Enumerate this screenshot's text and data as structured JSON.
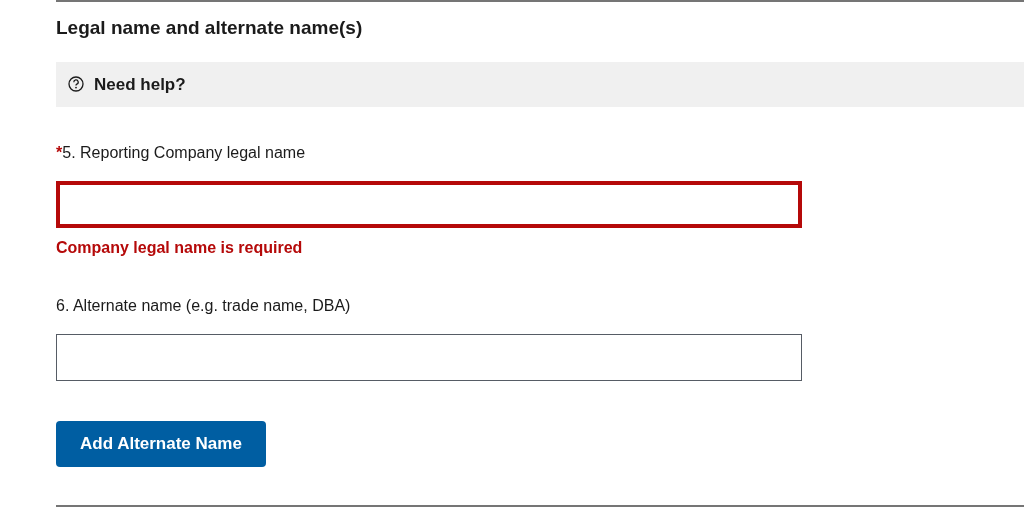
{
  "section": {
    "title": "Legal name and alternate name(s)"
  },
  "help": {
    "label": "Need help?"
  },
  "fields": [
    {
      "required_mark": "*",
      "label": "5. Reporting Company legal name",
      "invalid": true,
      "error": "Company legal name is required"
    },
    {
      "label": "6. Alternate name (e.g. trade name, DBA)",
      "invalid": false
    }
  ],
  "buttons": [
    {
      "label": "Add Alternate Name"
    }
  ]
}
